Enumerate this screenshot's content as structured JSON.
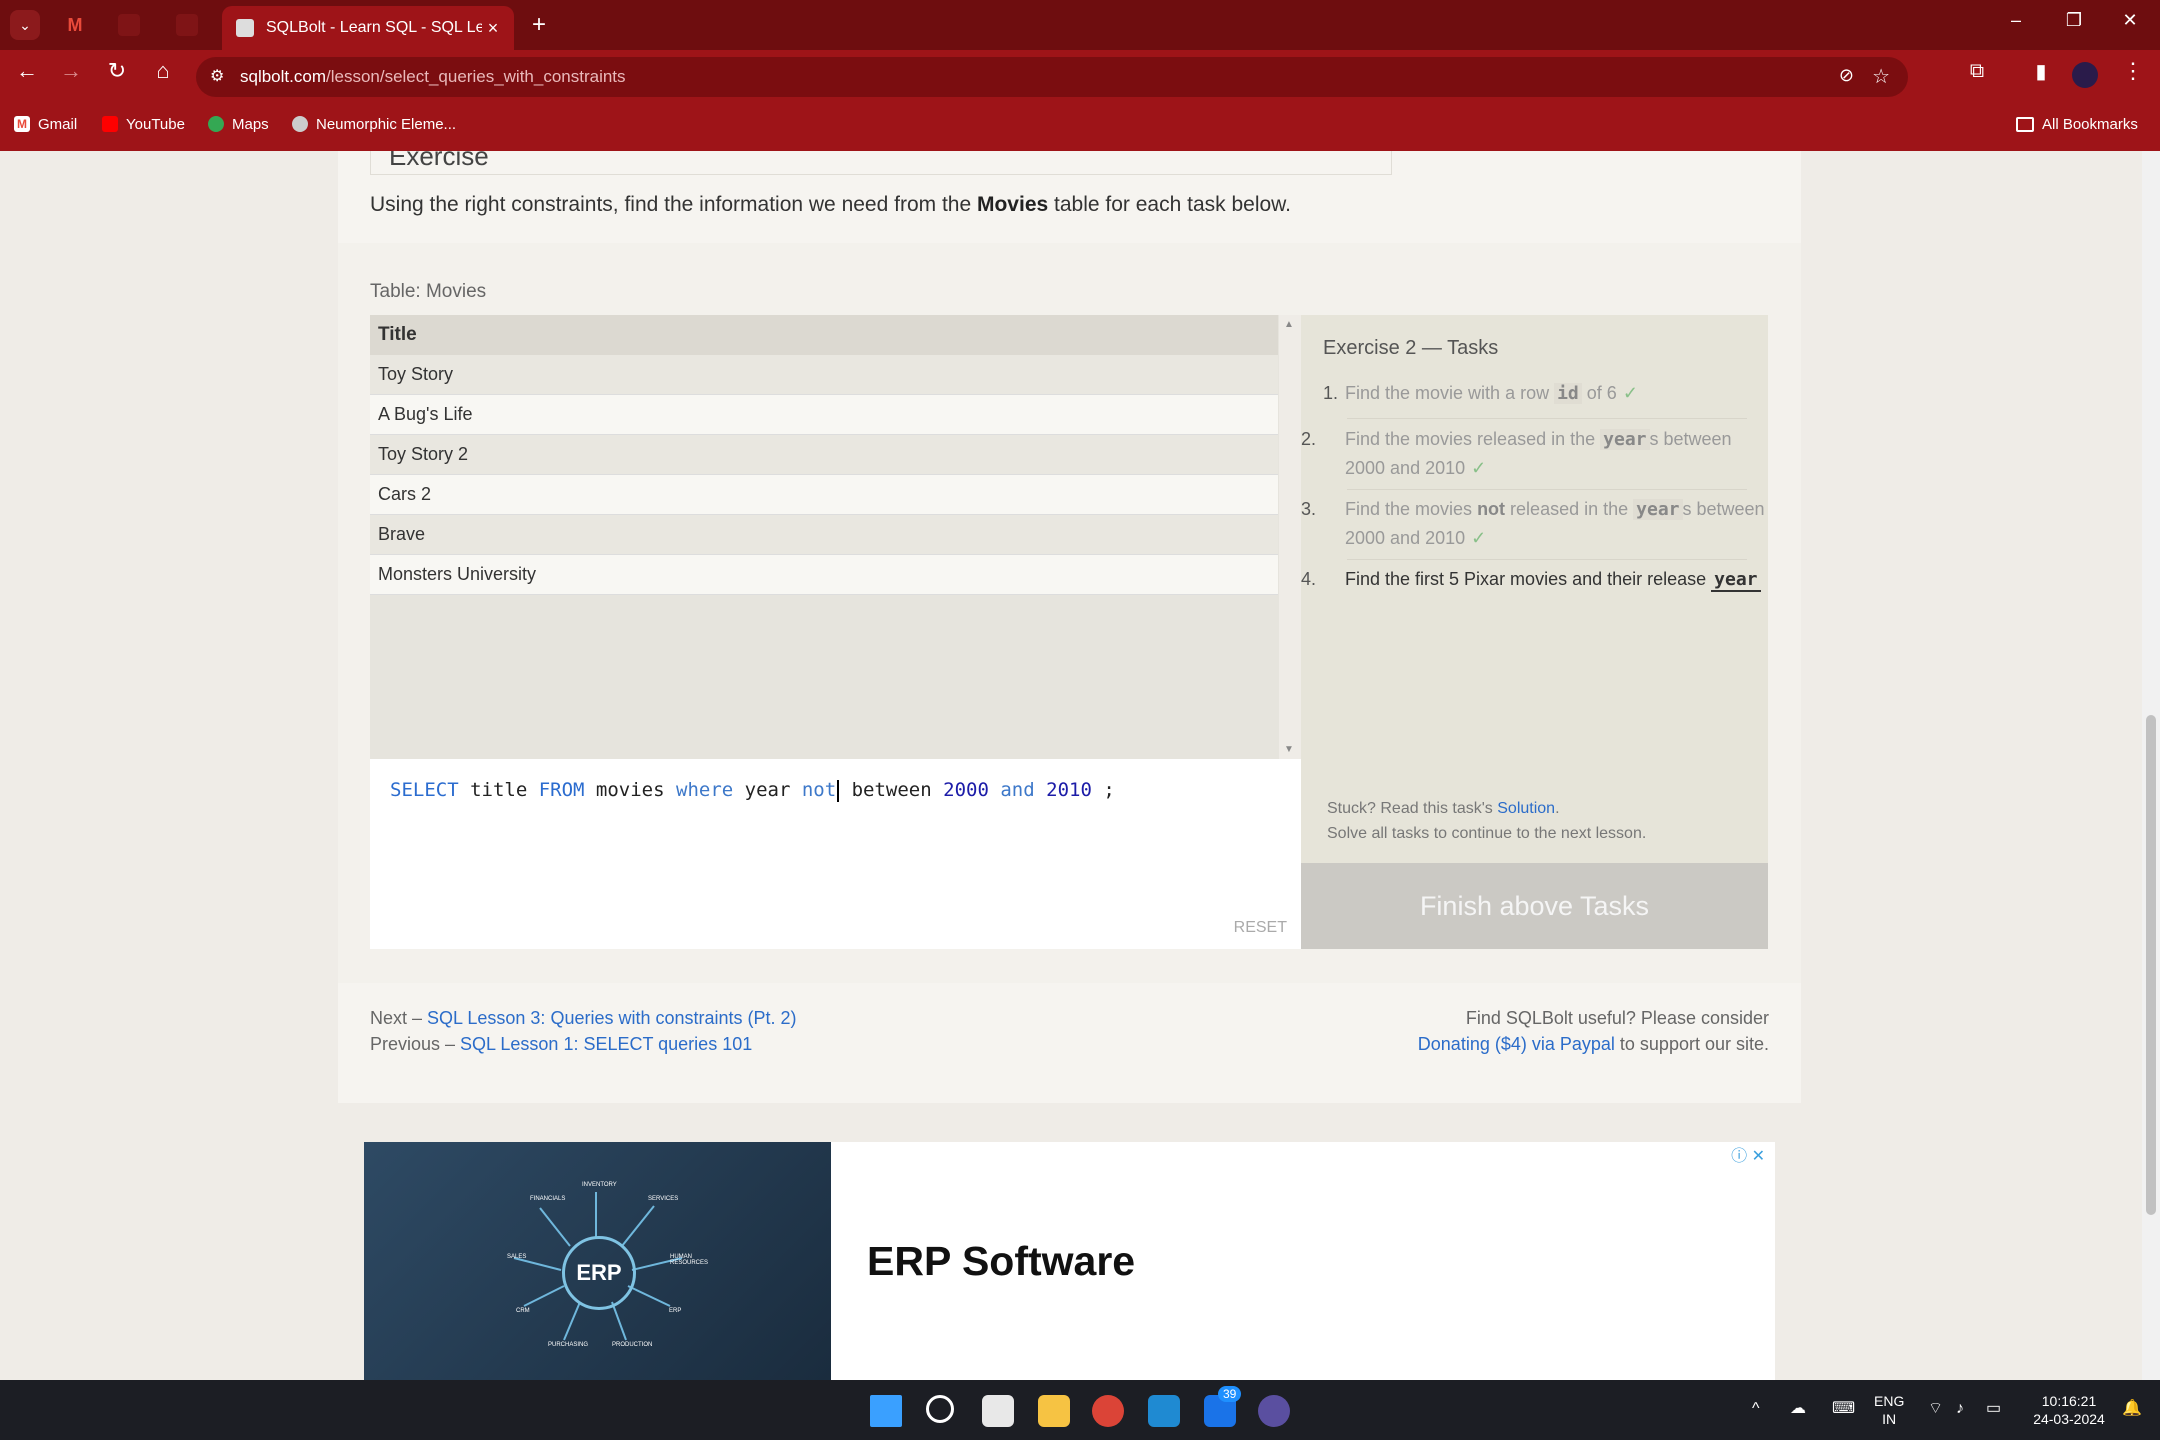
{
  "browser": {
    "active_tab_title": "SQLBolt - Learn SQL - SQL Less",
    "url_domain": "sqlbolt.com",
    "url_path": "/lesson/select_queries_with_constraints",
    "bookmarks": [
      {
        "label": "Gmail"
      },
      {
        "label": "YouTube"
      },
      {
        "label": "Maps"
      },
      {
        "label": "Neumorphic Eleme..."
      }
    ],
    "all_bookmarks": "All Bookmarks"
  },
  "lesson": {
    "exercise_heading": "Exercise",
    "intro_before": "Using the right constraints, find the information we need from the ",
    "intro_bold": "Movies",
    "intro_after": " table for each task below.",
    "table_caption": "Table: Movies",
    "table_header": "Title",
    "rows": [
      "Toy Story",
      "A Bug's Life",
      "Toy Story 2",
      "Cars 2",
      "Brave",
      "Monsters University"
    ],
    "query": {
      "select": "SELECT",
      "col": " title ",
      "from": "FROM",
      "table": " movies ",
      "where": "where",
      "field": " year ",
      "not_kw": "not",
      "between": " between ",
      "n1": "2000",
      "and": "and",
      "n2": "2010",
      "end": " ;"
    },
    "reset": "RESET",
    "tasks_title": "Exercise 2 — Tasks",
    "tasks": [
      {
        "num": "1.",
        "text_a": "Find the movie with a row ",
        "code": "id",
        "text_b": " of 6"
      },
      {
        "num": "2.",
        "text_a": "Find the movies released in the ",
        "code": "year",
        "text_b": "s between 2000 and 2010"
      },
      {
        "num": "3.",
        "text_a": "Find the movies ",
        "bold": "not",
        "text_mid": " released in the ",
        "code": "year",
        "text_b": "s between 2000 and 2010"
      },
      {
        "num": "4.",
        "text_a": "Find the first 5 Pixar movies and their release ",
        "code": "year"
      }
    ],
    "tick": "✓",
    "stuck_a": "Stuck? Read this task's ",
    "stuck_link": "Solution",
    "stuck_b": ".",
    "stuck_line2": "Solve all tasks to continue to the next lesson.",
    "finish_button": "Finish above Tasks",
    "next_prefix": "Next – ",
    "next_link": "SQL Lesson 3: Queries with constraints (Pt. 2)",
    "prev_prefix": "Previous – ",
    "prev_link": "SQL Lesson 1: SELECT queries 101",
    "useful_text": "Find SQLBolt useful? Please consider",
    "donate_link": "Donating ($4) via Paypal",
    "donate_after": " to support our site."
  },
  "ad": {
    "title": "ERP Software",
    "center_label": "ERP",
    "nodes": [
      "INVENTORY",
      "SERVICES",
      "FINANCIALS",
      "SALES",
      "HUMAN RESOURCES",
      "CRM",
      "ERP",
      "PURCHASING",
      "PRODUCTION"
    ]
  },
  "taskbar": {
    "lang1": "ENG",
    "lang2": "IN",
    "time": "10:16:21",
    "date": "24-03-2024",
    "badge": "39"
  }
}
